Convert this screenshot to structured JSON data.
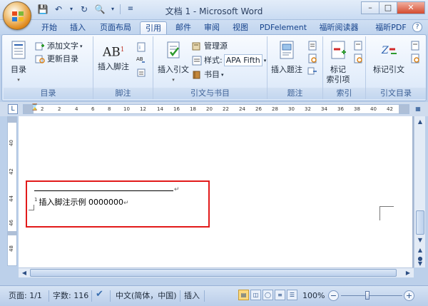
{
  "window": {
    "title": "文档 1 - Microsoft Word",
    "controls": [
      "–",
      "□",
      "✕"
    ]
  },
  "qat": {
    "icons": [
      "save-icon",
      "undo-icon",
      "redo-icon",
      "print-preview-icon",
      "customize-qat-icon"
    ]
  },
  "tabs": [
    {
      "label": "开始",
      "active": false
    },
    {
      "label": "插入",
      "active": false
    },
    {
      "label": "页面布局",
      "active": false
    },
    {
      "label": "引用",
      "active": true
    },
    {
      "label": "邮件",
      "active": false
    },
    {
      "label": "审阅",
      "active": false
    },
    {
      "label": "视图",
      "active": false
    },
    {
      "label": "PDFelement",
      "active": false
    },
    {
      "label": "福昕阅读器",
      "active": false
    },
    {
      "label": "福昕PDF",
      "active": false
    }
  ],
  "ribbon": {
    "toc": {
      "label": "目录",
      "big": "目录",
      "add_text": "添加文字",
      "update": "更新目录"
    },
    "footnote": {
      "label": "脚注",
      "insert": "插入脚注"
    },
    "citations": {
      "label": "引文与书目",
      "insert_citation": "插入引文",
      "manage": "管理源",
      "style_label": "样式:",
      "style_value": "APA Fifth",
      "bibliography": "书目"
    },
    "captions": {
      "label": "题注",
      "insert_caption": "插入题注"
    },
    "index": {
      "label": "索引",
      "mark_entry_1": "标记",
      "mark_entry_2": "索引项"
    },
    "toa": {
      "label": "引文目录",
      "mark_citation": "标记引文"
    }
  },
  "ruler": {
    "h_numbers": [
      "2",
      "2",
      "4",
      "6",
      "8",
      "10",
      "12",
      "14",
      "16",
      "18",
      "20",
      "22",
      "24",
      "26",
      "28",
      "30",
      "32",
      "34",
      "36",
      "38",
      "40",
      "42"
    ],
    "v_numbers": [
      "40",
      "42",
      "44",
      "46",
      "48"
    ]
  },
  "document": {
    "footnote_number": "1",
    "footnote_text": "插入脚注示例 0000000"
  },
  "status": {
    "page": "页面: 1/1",
    "words": "字数: 116",
    "language": "中文(简体，中国)",
    "mode": "插入",
    "zoom": "100%",
    "zoom_value": 100
  },
  "colors": {
    "highlight_border": "#e21a1a",
    "ribbon_label": "#3b5f95",
    "tab_text": "#15428b"
  }
}
